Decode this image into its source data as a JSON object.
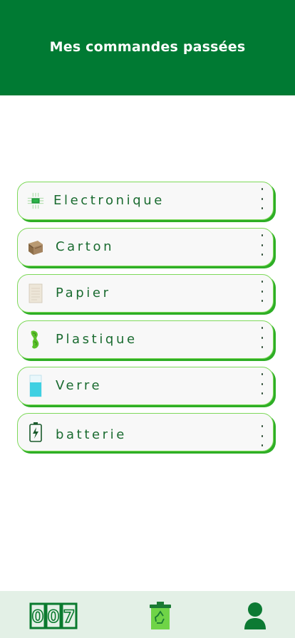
{
  "header": {
    "title": "Mes commandes passées"
  },
  "categories": [
    {
      "label": "Electronique",
      "icon": "chip-icon"
    },
    {
      "label": "Carton",
      "icon": "cardboard-box-icon"
    },
    {
      "label": "Papier",
      "icon": "paper-sheet-icon"
    },
    {
      "label": "Plastique",
      "icon": "plastic-bottle-icon"
    },
    {
      "label": "Verre",
      "icon": "glass-icon"
    },
    {
      "label": "batterie",
      "icon": "battery-icon"
    }
  ],
  "bottom_nav": {
    "items": [
      {
        "icon": "counter-icon",
        "counter_digits": [
          "0",
          "0",
          "7"
        ]
      },
      {
        "icon": "recycle-bin-icon"
      },
      {
        "icon": "user-profile-icon"
      }
    ]
  },
  "colors": {
    "header_bg": "#007a33",
    "card_border": "#7ed95a",
    "card_shadow": "#2eae26",
    "label_text": "#1a6b30",
    "nav_bg": "#e3f0e6"
  }
}
